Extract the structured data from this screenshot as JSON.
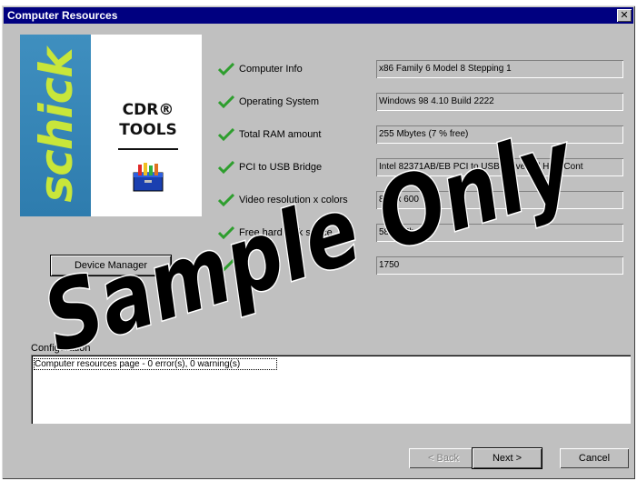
{
  "window": {
    "title": "Computer Resources",
    "close_glyph": "✕"
  },
  "logo": {
    "brand": "schick",
    "product_line1": "CDR®",
    "product_line2": "TOOLS"
  },
  "device_manager_label": "Device Manager",
  "checks": [
    {
      "label": "Computer Info",
      "value": "x86 Family 6 Model 8 Stepping 1",
      "status": "check-icon"
    },
    {
      "label": "Operating System",
      "value": "Windows 98 4.10 Build 2222",
      "status": "check-icon"
    },
    {
      "label": "Total RAM amount",
      "value": "255 Mbytes (7 % free)",
      "status": "check-icon"
    },
    {
      "label": "PCI to USB Bridge",
      "value": "Intel 82371AB/EB PCI to USB Universal Host Cont",
      "status": "check-icon"
    },
    {
      "label": "Video resolution x colors",
      "value": "800 x 600",
      "status": "check-icon"
    },
    {
      "label": "Free hard disk space",
      "value": "5860 Mbytes",
      "status": "check-icon"
    },
    {
      "label": "",
      "value": "1750",
      "status": "check-icon"
    }
  ],
  "log": {
    "label": "Configuration",
    "line": "Computer resources page - 0 error(s), 0 warning(s)"
  },
  "buttons": {
    "back": "< Back",
    "next": "Next >",
    "cancel": "Cancel"
  },
  "watermark": "Sample Only",
  "colors": {
    "title_bar": "#000080",
    "check": "#2e9e2e",
    "logo_blue": "#2e7cae",
    "logo_green": "#c8e63a"
  }
}
